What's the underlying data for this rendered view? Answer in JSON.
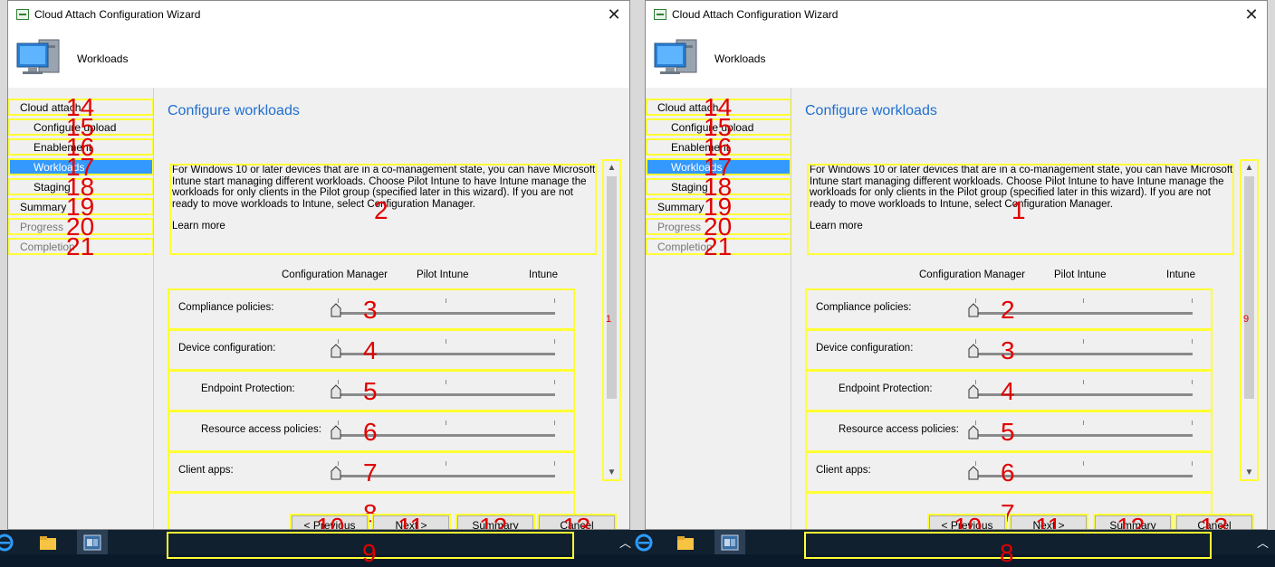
{
  "windows": [
    {
      "title": "Cloud Attach Configuration Wizard",
      "header": "Workloads",
      "nav": [
        {
          "label": "Cloud attach",
          "num": "14"
        },
        {
          "label": "Configure upload",
          "num": "15"
        },
        {
          "label": "Enablement",
          "num": "16"
        },
        {
          "label": "Workloads",
          "num": "17"
        },
        {
          "label": "Staging",
          "num": "18"
        },
        {
          "label": "Summary",
          "num": "19"
        },
        {
          "label": "Progress",
          "num": "20"
        },
        {
          "label": "Completion",
          "num": "21"
        }
      ],
      "heading": "Configure workloads",
      "description": "For Windows 10 or later devices that are in a co-management state, you can have Microsoft Intune start managing different workloads. Choose Pilot Intune to have Intune manage the workloads for only clients in the Pilot group (specified later in this wizard). If you are not ready to move workloads to Intune, select Configuration Manager.",
      "description_num": "2",
      "learn_more": "Learn more",
      "scroll_num": "1",
      "columns": [
        "Configuration Manager",
        "Pilot Intune",
        "Intune"
      ],
      "workloads": [
        {
          "label": "Compliance policies:",
          "num": "3"
        },
        {
          "label": "Device configuration:",
          "num": "4"
        },
        {
          "label": "Endpoint Protection:",
          "num": "5"
        },
        {
          "label": "Resource access policies:",
          "num": "6"
        },
        {
          "label": "Client apps:",
          "num": "7"
        }
      ],
      "row8_num": "8",
      "row9_num": "9",
      "buttons": [
        {
          "label": "< Previous",
          "num": "10"
        },
        {
          "label": "Next >",
          "num": "11"
        },
        {
          "label": "Summary",
          "num": "12"
        },
        {
          "label": "Cancel",
          "num": "13"
        }
      ]
    },
    {
      "title": "Cloud Attach Configuration Wizard",
      "header": "Workloads",
      "nav": [
        {
          "label": "Cloud attach",
          "num": "14"
        },
        {
          "label": "Configure upload",
          "num": "15"
        },
        {
          "label": "Enablement",
          "num": "16"
        },
        {
          "label": "Workloads",
          "num": "17"
        },
        {
          "label": "Staging",
          "num": "18"
        },
        {
          "label": "Summary",
          "num": "19"
        },
        {
          "label": "Progress",
          "num": "20"
        },
        {
          "label": "Completion",
          "num": "21"
        }
      ],
      "heading": "Configure workloads",
      "description": "For Windows 10 or later devices that are in a co-management state, you can have Microsoft Intune start managing different workloads. Choose Pilot Intune to have Intune manage the workloads for only clients in the Pilot group (specified later in this wizard). If you are not ready to move workloads to Intune, select Configuration Manager.",
      "description_num": "1",
      "learn_more": "Learn more",
      "scroll_num": "9",
      "columns": [
        "Configuration Manager",
        "Pilot Intune",
        "Intune"
      ],
      "workloads": [
        {
          "label": "Compliance policies:",
          "num": "2"
        },
        {
          "label": "Device configuration:",
          "num": "3"
        },
        {
          "label": "Endpoint Protection:",
          "num": "4"
        },
        {
          "label": "Resource access policies:",
          "num": "5"
        },
        {
          "label": "Client apps:",
          "num": "6"
        }
      ],
      "row8_num": "7",
      "row9_num": "8",
      "buttons": [
        {
          "label": "< Previous",
          "num": "10"
        },
        {
          "label": "Next >",
          "num": "11"
        },
        {
          "label": "Summary",
          "num": "12"
        },
        {
          "label": "Cancel",
          "num": "13"
        }
      ]
    }
  ],
  "colors": {
    "accent": "#3399ff",
    "heading": "#1f6fd0",
    "annotation_box": "#ffff33",
    "annotation_num": "#e00000"
  }
}
